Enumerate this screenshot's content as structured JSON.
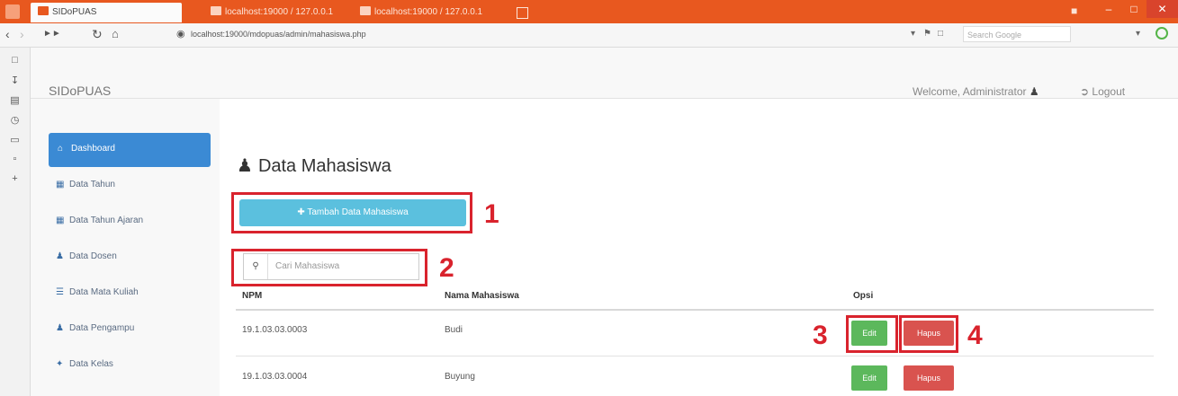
{
  "browser": {
    "tabs": [
      {
        "label": "SIDoPUAS",
        "active": true
      },
      {
        "label": "localhost:19000 / 127.0.0.1",
        "active": false
      },
      {
        "label": "localhost:19000 / 127.0.0.1",
        "active": false
      }
    ],
    "url": "localhost:19000/mdopuas/admin/mahasiswa.php",
    "search_placeholder": "Search Google",
    "accent_color": "#e8581f"
  },
  "navbar": {
    "brand": "SIDoPUAS",
    "welcome": "Welcome, Administrator",
    "logout": "Logout"
  },
  "sidebar": {
    "items": [
      {
        "label": "Dashboard",
        "icon": "home-icon",
        "active": true
      },
      {
        "label": "Data Tahun",
        "icon": "table-icon"
      },
      {
        "label": "Data Tahun Ajaran",
        "icon": "table-icon"
      },
      {
        "label": "Data Dosen",
        "icon": "user-icon"
      },
      {
        "label": "Data Mata Kuliah",
        "icon": "list-icon"
      },
      {
        "label": "Data Pengampu",
        "icon": "user-icon"
      },
      {
        "label": "Data Kelas",
        "icon": "wrench-icon"
      }
    ]
  },
  "main": {
    "title": "Data Mahasiswa",
    "add_button": "Tambah Data Mahasiswa",
    "search_placeholder": "Cari Mahasiswa",
    "table": {
      "headers": [
        "NPM",
        "Nama Mahasiswa",
        "Opsi"
      ],
      "rows": [
        {
          "npm": "19.1.03.03.0003",
          "nama": "Budi"
        },
        {
          "npm": "19.1.03.03.0004",
          "nama": "Buyung"
        }
      ],
      "edit_label": "Edit",
      "hapus_label": "Hapus"
    }
  },
  "annotations": [
    "1",
    "2",
    "3",
    "4"
  ]
}
